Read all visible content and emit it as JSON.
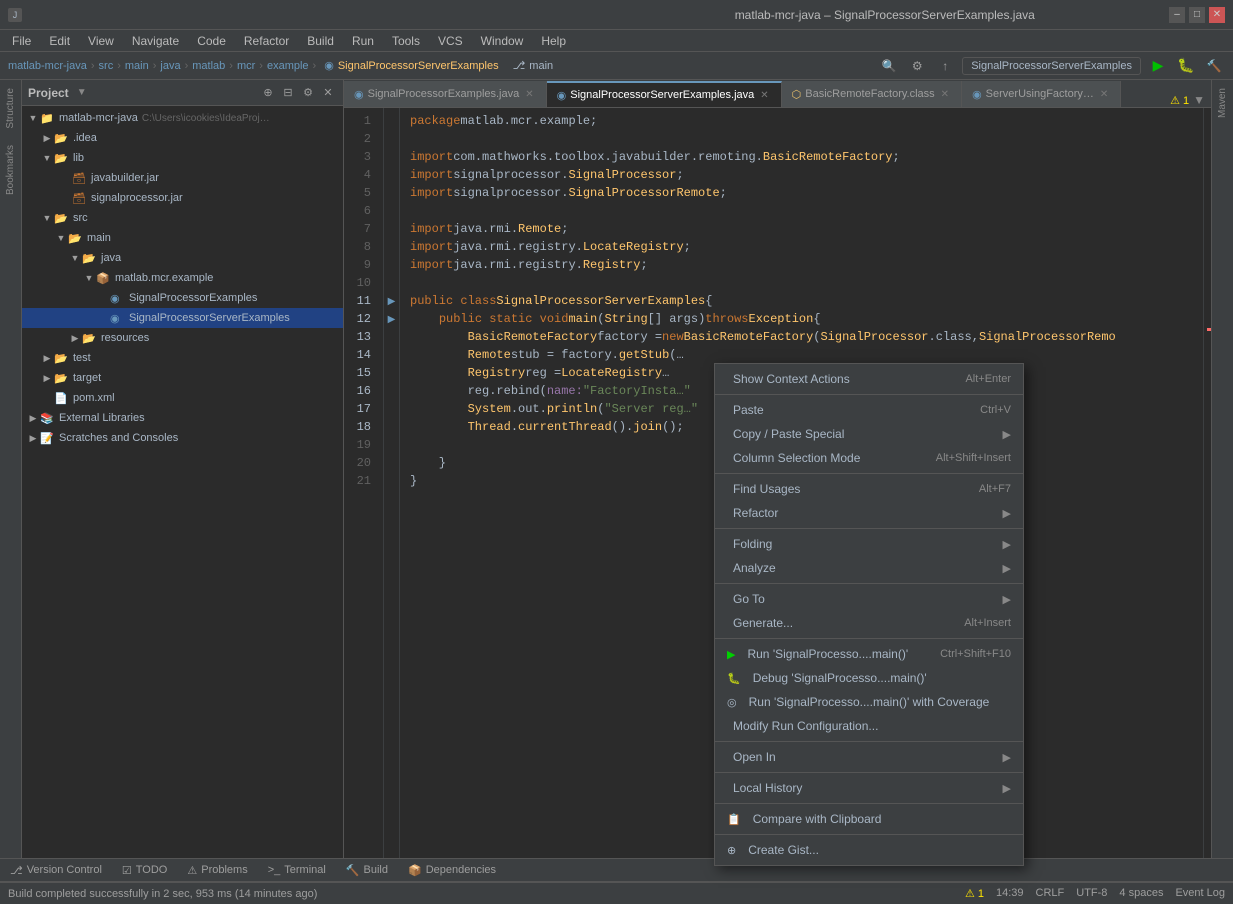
{
  "titleBar": {
    "title": "matlab-mcr-java – SignalProcessorServerExamples.java",
    "controls": [
      "–",
      "□",
      "✕"
    ]
  },
  "menuBar": {
    "items": [
      "File",
      "Edit",
      "View",
      "Navigate",
      "Code",
      "Refactor",
      "Build",
      "Run",
      "Tools",
      "VCS",
      "Window",
      "Help"
    ]
  },
  "navBar": {
    "crumbs": [
      "matlab-mcr-java",
      "src",
      "main",
      "java",
      "matlab",
      "mcr",
      "example"
    ],
    "current": "SignalProcessorServerExamples",
    "branch": "main"
  },
  "toolbar": {
    "projectName": "SignalProcessorServerExamples",
    "runBtn": "▶",
    "debugBtn": "🐛",
    "buildBtn": "🔨"
  },
  "tabs": [
    {
      "label": "SignalProcessorExamples.java",
      "type": "java",
      "active": false
    },
    {
      "label": "SignalProcessorServerExamples.java",
      "type": "java",
      "active": true
    },
    {
      "label": "BasicRemoteFactory.class",
      "type": "class",
      "active": false
    },
    {
      "label": "ServerUsingFactory…",
      "type": "java",
      "active": false
    }
  ],
  "codeLines": [
    {
      "num": 1,
      "text": "package matlab.mcr.example;"
    },
    {
      "num": 2,
      "text": ""
    },
    {
      "num": 3,
      "text": "import com.mathworks.toolbox.javabuilder.remoting.BasicRemoteFactory;"
    },
    {
      "num": 4,
      "text": "import signalprocessor.SignalProcessor;"
    },
    {
      "num": 5,
      "text": "import signalprocessor.SignalProcessorRemote;"
    },
    {
      "num": 6,
      "text": ""
    },
    {
      "num": 7,
      "text": "import java.rmi.Remote;"
    },
    {
      "num": 8,
      "text": "import java.rmi.registry.LocateRegistry;"
    },
    {
      "num": 9,
      "text": "import java.rmi.registry.Registry;"
    },
    {
      "num": 10,
      "text": ""
    },
    {
      "num": 11,
      "text": "public class SignalProcessorServerExamples {"
    },
    {
      "num": 12,
      "text": "    public static void main(String[] args)throws Exception {"
    },
    {
      "num": 13,
      "text": "        BasicRemoteFactory factory = new BasicRemoteFactory(SignalProcessor.class, SignalProcessorRemo"
    },
    {
      "num": 14,
      "text": "        Remote stub = factory.getStub(…"
    },
    {
      "num": 15,
      "text": "        Registry reg = LocateRegistry…"
    },
    {
      "num": 16,
      "text": "        reg.rebind( name: \"FactoryInsta…"
    },
    {
      "num": 17,
      "text": "        System.out.println(\"Server reg…"
    },
    {
      "num": 18,
      "text": "        Thread.currentThread().join();"
    },
    {
      "num": 19,
      "text": ""
    },
    {
      "num": 20,
      "text": "    }"
    },
    {
      "num": 21,
      "text": ""
    }
  ],
  "projectTree": {
    "items": [
      {
        "label": "matlab-mcr-java",
        "type": "project",
        "indent": 0,
        "expanded": true
      },
      {
        "label": ".idea",
        "type": "folder",
        "indent": 1,
        "expanded": false
      },
      {
        "label": "lib",
        "type": "folder",
        "indent": 1,
        "expanded": true
      },
      {
        "label": "javabuilder.jar",
        "type": "jar",
        "indent": 2
      },
      {
        "label": "signalprocessor.jar",
        "type": "jar",
        "indent": 2
      },
      {
        "label": "src",
        "type": "folder",
        "indent": 1,
        "expanded": true
      },
      {
        "label": "main",
        "type": "folder",
        "indent": 2,
        "expanded": true
      },
      {
        "label": "java",
        "type": "folder",
        "indent": 3,
        "expanded": true
      },
      {
        "label": "matlab.mcr.example",
        "type": "package",
        "indent": 4,
        "expanded": true
      },
      {
        "label": "SignalProcessorExamples",
        "type": "java",
        "indent": 5
      },
      {
        "label": "SignalProcessorServerExamples",
        "type": "java",
        "indent": 5,
        "selected": true
      },
      {
        "label": "resources",
        "type": "folder",
        "indent": 3,
        "expanded": false
      },
      {
        "label": "test",
        "type": "folder",
        "indent": 1,
        "expanded": false
      },
      {
        "label": "target",
        "type": "folder",
        "indent": 1,
        "expanded": false
      },
      {
        "label": "pom.xml",
        "type": "xml",
        "indent": 1
      },
      {
        "label": "External Libraries",
        "type": "library",
        "indent": 0,
        "expanded": false
      },
      {
        "label": "Scratches and Consoles",
        "type": "scratches",
        "indent": 0,
        "expanded": false
      }
    ]
  },
  "contextMenu": {
    "items": [
      {
        "type": "item",
        "label": "Show Context Actions",
        "shortcut": "Alt+Enter",
        "icon": ""
      },
      {
        "type": "sep"
      },
      {
        "type": "item",
        "label": "Paste",
        "shortcut": "Ctrl+V",
        "icon": ""
      },
      {
        "type": "item",
        "label": "Copy / Paste Special",
        "arrow": "▶",
        "icon": ""
      },
      {
        "type": "item",
        "label": "Column Selection Mode",
        "shortcut": "Alt+Shift+Insert",
        "icon": ""
      },
      {
        "type": "sep"
      },
      {
        "type": "item",
        "label": "Find Usages",
        "shortcut": "Alt+F7",
        "icon": ""
      },
      {
        "type": "item",
        "label": "Refactor",
        "arrow": "▶",
        "icon": ""
      },
      {
        "type": "sep"
      },
      {
        "type": "item",
        "label": "Folding",
        "arrow": "▶",
        "icon": ""
      },
      {
        "type": "item",
        "label": "Analyze",
        "arrow": "▶",
        "icon": ""
      },
      {
        "type": "sep"
      },
      {
        "type": "item",
        "label": "Go To",
        "arrow": "▶",
        "icon": ""
      },
      {
        "type": "item",
        "label": "Generate...",
        "shortcut": "Alt+Insert",
        "icon": ""
      },
      {
        "type": "sep"
      },
      {
        "type": "item",
        "label": "Run 'SignalProcesso....main()'",
        "shortcut": "Ctrl+Shift+F10",
        "iconType": "run"
      },
      {
        "type": "item",
        "label": "Debug 'SignalProcesso....main()'",
        "shortcut": "",
        "iconType": "debug"
      },
      {
        "type": "item",
        "label": "Run 'SignalProcesso....main()' with Coverage",
        "shortcut": "",
        "iconType": "coverage"
      },
      {
        "type": "item",
        "label": "Modify Run Configuration...",
        "shortcut": "",
        "icon": ""
      },
      {
        "type": "sep"
      },
      {
        "type": "item",
        "label": "Open In",
        "arrow": "▶",
        "icon": ""
      },
      {
        "type": "sep"
      },
      {
        "type": "item",
        "label": "Local History",
        "arrow": "▶",
        "icon": ""
      },
      {
        "type": "sep"
      },
      {
        "type": "item",
        "label": "Compare with Clipboard",
        "shortcut": "",
        "iconType": "clipboard"
      },
      {
        "type": "sep"
      },
      {
        "type": "item",
        "label": "Create Gist...",
        "shortcut": "",
        "iconType": "gist"
      }
    ]
  },
  "bottomTabs": [
    {
      "label": "Version Control",
      "icon": "⎇",
      "active": false
    },
    {
      "label": "TODO",
      "icon": "☑",
      "active": false
    },
    {
      "label": "Problems",
      "icon": "⚠",
      "active": false
    },
    {
      "label": "Terminal",
      "icon": ">_",
      "active": false
    },
    {
      "label": "Build",
      "icon": "🔨",
      "active": false
    },
    {
      "label": "Dependencies",
      "icon": "📦",
      "active": false
    }
  ],
  "statusBar": {
    "buildMsg": "Build completed successfully in 2 sec, 953 ms (14 minutes ago)",
    "time": "14:39",
    "lineEnding": "CRLF",
    "encoding": "UTF-8",
    "indentSize": "4 spaces",
    "warningCount": "1",
    "eventLog": "Event Log"
  },
  "sideStrips": {
    "left": [
      "Structure",
      "Bookmarks"
    ],
    "right": [
      "Maven"
    ]
  }
}
